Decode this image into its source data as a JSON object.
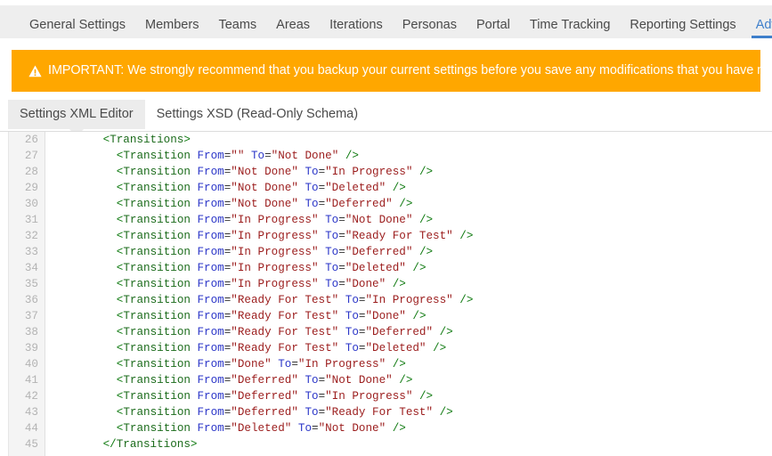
{
  "topnav": {
    "items": [
      {
        "label": "General Settings",
        "active": false
      },
      {
        "label": "Members",
        "active": false
      },
      {
        "label": "Teams",
        "active": false
      },
      {
        "label": "Areas",
        "active": false
      },
      {
        "label": "Iterations",
        "active": false
      },
      {
        "label": "Personas",
        "active": false
      },
      {
        "label": "Portal",
        "active": false
      },
      {
        "label": "Time Tracking",
        "active": false
      },
      {
        "label": "Reporting Settings",
        "active": false
      },
      {
        "label": "Advanced Settings",
        "active": true
      }
    ],
    "active_color": "#3e7fcb"
  },
  "banner": {
    "icon": "warning-triangle-icon",
    "text": "IMPORTANT: We strongly recommend that you backup your current settings before you save any modifications that you have made.",
    "background_color": "#ffa700",
    "text_color": "#ffffff"
  },
  "subtabs": {
    "items": [
      {
        "label": "Settings XML Editor",
        "active": true
      },
      {
        "label": "Settings XSD (Read-Only Schema)",
        "active": false
      }
    ]
  },
  "editor": {
    "first_line_number": 26,
    "colors": {
      "tag": "#1b6b1b",
      "punctuation": "#0f7a10",
      "attribute": "#2b36c8",
      "value": "#9b1c1c",
      "line_number": "#b3b3b3",
      "gutter_background": "#f4f4f4"
    },
    "lines": [
      {
        "number": "26",
        "indent": 8,
        "tokens": [
          {
            "t": "punc",
            "v": "<"
          },
          {
            "t": "tag",
            "v": "Transitions"
          },
          {
            "t": "punc",
            "v": ">"
          }
        ]
      },
      {
        "number": "27",
        "indent": 10,
        "tokens": [
          {
            "t": "punc",
            "v": "<"
          },
          {
            "t": "tag",
            "v": "Transition"
          },
          {
            "t": "plain",
            "v": " "
          },
          {
            "t": "attr",
            "v": "From"
          },
          {
            "t": "eq",
            "v": "="
          },
          {
            "t": "val",
            "v": "\"\""
          },
          {
            "t": "plain",
            "v": " "
          },
          {
            "t": "attr",
            "v": "To"
          },
          {
            "t": "eq",
            "v": "="
          },
          {
            "t": "val",
            "v": "\"Not Done\""
          },
          {
            "t": "plain",
            "v": " "
          },
          {
            "t": "punc",
            "v": "/>"
          }
        ]
      },
      {
        "number": "28",
        "indent": 10,
        "tokens": [
          {
            "t": "punc",
            "v": "<"
          },
          {
            "t": "tag",
            "v": "Transition"
          },
          {
            "t": "plain",
            "v": " "
          },
          {
            "t": "attr",
            "v": "From"
          },
          {
            "t": "eq",
            "v": "="
          },
          {
            "t": "val",
            "v": "\"Not Done\""
          },
          {
            "t": "plain",
            "v": " "
          },
          {
            "t": "attr",
            "v": "To"
          },
          {
            "t": "eq",
            "v": "="
          },
          {
            "t": "val",
            "v": "\"In Progress\""
          },
          {
            "t": "plain",
            "v": " "
          },
          {
            "t": "punc",
            "v": "/>"
          }
        ]
      },
      {
        "number": "29",
        "indent": 10,
        "tokens": [
          {
            "t": "punc",
            "v": "<"
          },
          {
            "t": "tag",
            "v": "Transition"
          },
          {
            "t": "plain",
            "v": " "
          },
          {
            "t": "attr",
            "v": "From"
          },
          {
            "t": "eq",
            "v": "="
          },
          {
            "t": "val",
            "v": "\"Not Done\""
          },
          {
            "t": "plain",
            "v": " "
          },
          {
            "t": "attr",
            "v": "To"
          },
          {
            "t": "eq",
            "v": "="
          },
          {
            "t": "val",
            "v": "\"Deleted\""
          },
          {
            "t": "plain",
            "v": " "
          },
          {
            "t": "punc",
            "v": "/>"
          }
        ]
      },
      {
        "number": "30",
        "indent": 10,
        "tokens": [
          {
            "t": "punc",
            "v": "<"
          },
          {
            "t": "tag",
            "v": "Transition"
          },
          {
            "t": "plain",
            "v": " "
          },
          {
            "t": "attr",
            "v": "From"
          },
          {
            "t": "eq",
            "v": "="
          },
          {
            "t": "val",
            "v": "\"Not Done\""
          },
          {
            "t": "plain",
            "v": " "
          },
          {
            "t": "attr",
            "v": "To"
          },
          {
            "t": "eq",
            "v": "="
          },
          {
            "t": "val",
            "v": "\"Deferred\""
          },
          {
            "t": "plain",
            "v": " "
          },
          {
            "t": "punc",
            "v": "/>"
          }
        ]
      },
      {
        "number": "31",
        "indent": 10,
        "tokens": [
          {
            "t": "punc",
            "v": "<"
          },
          {
            "t": "tag",
            "v": "Transition"
          },
          {
            "t": "plain",
            "v": " "
          },
          {
            "t": "attr",
            "v": "From"
          },
          {
            "t": "eq",
            "v": "="
          },
          {
            "t": "val",
            "v": "\"In Progress\""
          },
          {
            "t": "plain",
            "v": " "
          },
          {
            "t": "attr",
            "v": "To"
          },
          {
            "t": "eq",
            "v": "="
          },
          {
            "t": "val",
            "v": "\"Not Done\""
          },
          {
            "t": "plain",
            "v": " "
          },
          {
            "t": "punc",
            "v": "/>"
          }
        ]
      },
      {
        "number": "32",
        "indent": 10,
        "tokens": [
          {
            "t": "punc",
            "v": "<"
          },
          {
            "t": "tag",
            "v": "Transition"
          },
          {
            "t": "plain",
            "v": " "
          },
          {
            "t": "attr",
            "v": "From"
          },
          {
            "t": "eq",
            "v": "="
          },
          {
            "t": "val",
            "v": "\"In Progress\""
          },
          {
            "t": "plain",
            "v": " "
          },
          {
            "t": "attr",
            "v": "To"
          },
          {
            "t": "eq",
            "v": "="
          },
          {
            "t": "val",
            "v": "\"Ready For Test\""
          },
          {
            "t": "plain",
            "v": " "
          },
          {
            "t": "punc",
            "v": "/>"
          }
        ]
      },
      {
        "number": "33",
        "indent": 10,
        "tokens": [
          {
            "t": "punc",
            "v": "<"
          },
          {
            "t": "tag",
            "v": "Transition"
          },
          {
            "t": "plain",
            "v": " "
          },
          {
            "t": "attr",
            "v": "From"
          },
          {
            "t": "eq",
            "v": "="
          },
          {
            "t": "val",
            "v": "\"In Progress\""
          },
          {
            "t": "plain",
            "v": " "
          },
          {
            "t": "attr",
            "v": "To"
          },
          {
            "t": "eq",
            "v": "="
          },
          {
            "t": "val",
            "v": "\"Deferred\""
          },
          {
            "t": "plain",
            "v": " "
          },
          {
            "t": "punc",
            "v": "/>"
          }
        ]
      },
      {
        "number": "34",
        "indent": 10,
        "tokens": [
          {
            "t": "punc",
            "v": "<"
          },
          {
            "t": "tag",
            "v": "Transition"
          },
          {
            "t": "plain",
            "v": " "
          },
          {
            "t": "attr",
            "v": "From"
          },
          {
            "t": "eq",
            "v": "="
          },
          {
            "t": "val",
            "v": "\"In Progress\""
          },
          {
            "t": "plain",
            "v": " "
          },
          {
            "t": "attr",
            "v": "To"
          },
          {
            "t": "eq",
            "v": "="
          },
          {
            "t": "val",
            "v": "\"Deleted\""
          },
          {
            "t": "plain",
            "v": " "
          },
          {
            "t": "punc",
            "v": "/>"
          }
        ]
      },
      {
        "number": "35",
        "indent": 10,
        "tokens": [
          {
            "t": "punc",
            "v": "<"
          },
          {
            "t": "tag",
            "v": "Transition"
          },
          {
            "t": "plain",
            "v": " "
          },
          {
            "t": "attr",
            "v": "From"
          },
          {
            "t": "eq",
            "v": "="
          },
          {
            "t": "val",
            "v": "\"In Progress\""
          },
          {
            "t": "plain",
            "v": " "
          },
          {
            "t": "attr",
            "v": "To"
          },
          {
            "t": "eq",
            "v": "="
          },
          {
            "t": "val",
            "v": "\"Done\""
          },
          {
            "t": "plain",
            "v": " "
          },
          {
            "t": "punc",
            "v": "/>"
          }
        ]
      },
      {
        "number": "36",
        "indent": 10,
        "tokens": [
          {
            "t": "punc",
            "v": "<"
          },
          {
            "t": "tag",
            "v": "Transition"
          },
          {
            "t": "plain",
            "v": " "
          },
          {
            "t": "attr",
            "v": "From"
          },
          {
            "t": "eq",
            "v": "="
          },
          {
            "t": "val",
            "v": "\"Ready For Test\""
          },
          {
            "t": "plain",
            "v": " "
          },
          {
            "t": "attr",
            "v": "To"
          },
          {
            "t": "eq",
            "v": "="
          },
          {
            "t": "val",
            "v": "\"In Progress\""
          },
          {
            "t": "plain",
            "v": " "
          },
          {
            "t": "punc",
            "v": "/>"
          }
        ]
      },
      {
        "number": "37",
        "indent": 10,
        "tokens": [
          {
            "t": "punc",
            "v": "<"
          },
          {
            "t": "tag",
            "v": "Transition"
          },
          {
            "t": "plain",
            "v": " "
          },
          {
            "t": "attr",
            "v": "From"
          },
          {
            "t": "eq",
            "v": "="
          },
          {
            "t": "val",
            "v": "\"Ready For Test\""
          },
          {
            "t": "plain",
            "v": " "
          },
          {
            "t": "attr",
            "v": "To"
          },
          {
            "t": "eq",
            "v": "="
          },
          {
            "t": "val",
            "v": "\"Done\""
          },
          {
            "t": "plain",
            "v": " "
          },
          {
            "t": "punc",
            "v": "/>"
          }
        ]
      },
      {
        "number": "38",
        "indent": 10,
        "tokens": [
          {
            "t": "punc",
            "v": "<"
          },
          {
            "t": "tag",
            "v": "Transition"
          },
          {
            "t": "plain",
            "v": " "
          },
          {
            "t": "attr",
            "v": "From"
          },
          {
            "t": "eq",
            "v": "="
          },
          {
            "t": "val",
            "v": "\"Ready For Test\""
          },
          {
            "t": "plain",
            "v": " "
          },
          {
            "t": "attr",
            "v": "To"
          },
          {
            "t": "eq",
            "v": "="
          },
          {
            "t": "val",
            "v": "\"Deferred\""
          },
          {
            "t": "plain",
            "v": " "
          },
          {
            "t": "punc",
            "v": "/>"
          }
        ]
      },
      {
        "number": "39",
        "indent": 10,
        "tokens": [
          {
            "t": "punc",
            "v": "<"
          },
          {
            "t": "tag",
            "v": "Transition"
          },
          {
            "t": "plain",
            "v": " "
          },
          {
            "t": "attr",
            "v": "From"
          },
          {
            "t": "eq",
            "v": "="
          },
          {
            "t": "val",
            "v": "\"Ready For Test\""
          },
          {
            "t": "plain",
            "v": " "
          },
          {
            "t": "attr",
            "v": "To"
          },
          {
            "t": "eq",
            "v": "="
          },
          {
            "t": "val",
            "v": "\"Deleted\""
          },
          {
            "t": "plain",
            "v": " "
          },
          {
            "t": "punc",
            "v": "/>"
          }
        ]
      },
      {
        "number": "40",
        "indent": 10,
        "tokens": [
          {
            "t": "punc",
            "v": "<"
          },
          {
            "t": "tag",
            "v": "Transition"
          },
          {
            "t": "plain",
            "v": " "
          },
          {
            "t": "attr",
            "v": "From"
          },
          {
            "t": "eq",
            "v": "="
          },
          {
            "t": "val",
            "v": "\"Done\""
          },
          {
            "t": "plain",
            "v": " "
          },
          {
            "t": "attr",
            "v": "To"
          },
          {
            "t": "eq",
            "v": "="
          },
          {
            "t": "val",
            "v": "\"In Progress\""
          },
          {
            "t": "plain",
            "v": " "
          },
          {
            "t": "punc",
            "v": "/>"
          }
        ]
      },
      {
        "number": "41",
        "indent": 10,
        "tokens": [
          {
            "t": "punc",
            "v": "<"
          },
          {
            "t": "tag",
            "v": "Transition"
          },
          {
            "t": "plain",
            "v": " "
          },
          {
            "t": "attr",
            "v": "From"
          },
          {
            "t": "eq",
            "v": "="
          },
          {
            "t": "val",
            "v": "\"Deferred\""
          },
          {
            "t": "plain",
            "v": " "
          },
          {
            "t": "attr",
            "v": "To"
          },
          {
            "t": "eq",
            "v": "="
          },
          {
            "t": "val",
            "v": "\"Not Done\""
          },
          {
            "t": "plain",
            "v": " "
          },
          {
            "t": "punc",
            "v": "/>"
          }
        ]
      },
      {
        "number": "42",
        "indent": 10,
        "tokens": [
          {
            "t": "punc",
            "v": "<"
          },
          {
            "t": "tag",
            "v": "Transition"
          },
          {
            "t": "plain",
            "v": " "
          },
          {
            "t": "attr",
            "v": "From"
          },
          {
            "t": "eq",
            "v": "="
          },
          {
            "t": "val",
            "v": "\"Deferred\""
          },
          {
            "t": "plain",
            "v": " "
          },
          {
            "t": "attr",
            "v": "To"
          },
          {
            "t": "eq",
            "v": "="
          },
          {
            "t": "val",
            "v": "\"In Progress\""
          },
          {
            "t": "plain",
            "v": " "
          },
          {
            "t": "punc",
            "v": "/>"
          }
        ]
      },
      {
        "number": "43",
        "indent": 10,
        "tokens": [
          {
            "t": "punc",
            "v": "<"
          },
          {
            "t": "tag",
            "v": "Transition"
          },
          {
            "t": "plain",
            "v": " "
          },
          {
            "t": "attr",
            "v": "From"
          },
          {
            "t": "eq",
            "v": "="
          },
          {
            "t": "val",
            "v": "\"Deferred\""
          },
          {
            "t": "plain",
            "v": " "
          },
          {
            "t": "attr",
            "v": "To"
          },
          {
            "t": "eq",
            "v": "="
          },
          {
            "t": "val",
            "v": "\"Ready For Test\""
          },
          {
            "t": "plain",
            "v": " "
          },
          {
            "t": "punc",
            "v": "/>"
          }
        ]
      },
      {
        "number": "44",
        "indent": 10,
        "tokens": [
          {
            "t": "punc",
            "v": "<"
          },
          {
            "t": "tag",
            "v": "Transition"
          },
          {
            "t": "plain",
            "v": " "
          },
          {
            "t": "attr",
            "v": "From"
          },
          {
            "t": "eq",
            "v": "="
          },
          {
            "t": "val",
            "v": "\"Deleted\""
          },
          {
            "t": "plain",
            "v": " "
          },
          {
            "t": "attr",
            "v": "To"
          },
          {
            "t": "eq",
            "v": "="
          },
          {
            "t": "val",
            "v": "\"Not Done\""
          },
          {
            "t": "plain",
            "v": " "
          },
          {
            "t": "punc",
            "v": "/>"
          }
        ]
      },
      {
        "number": "45",
        "indent": 8,
        "tokens": [
          {
            "t": "punc",
            "v": "</"
          },
          {
            "t": "tag",
            "v": "Transitions"
          },
          {
            "t": "punc",
            "v": ">"
          }
        ]
      }
    ]
  }
}
